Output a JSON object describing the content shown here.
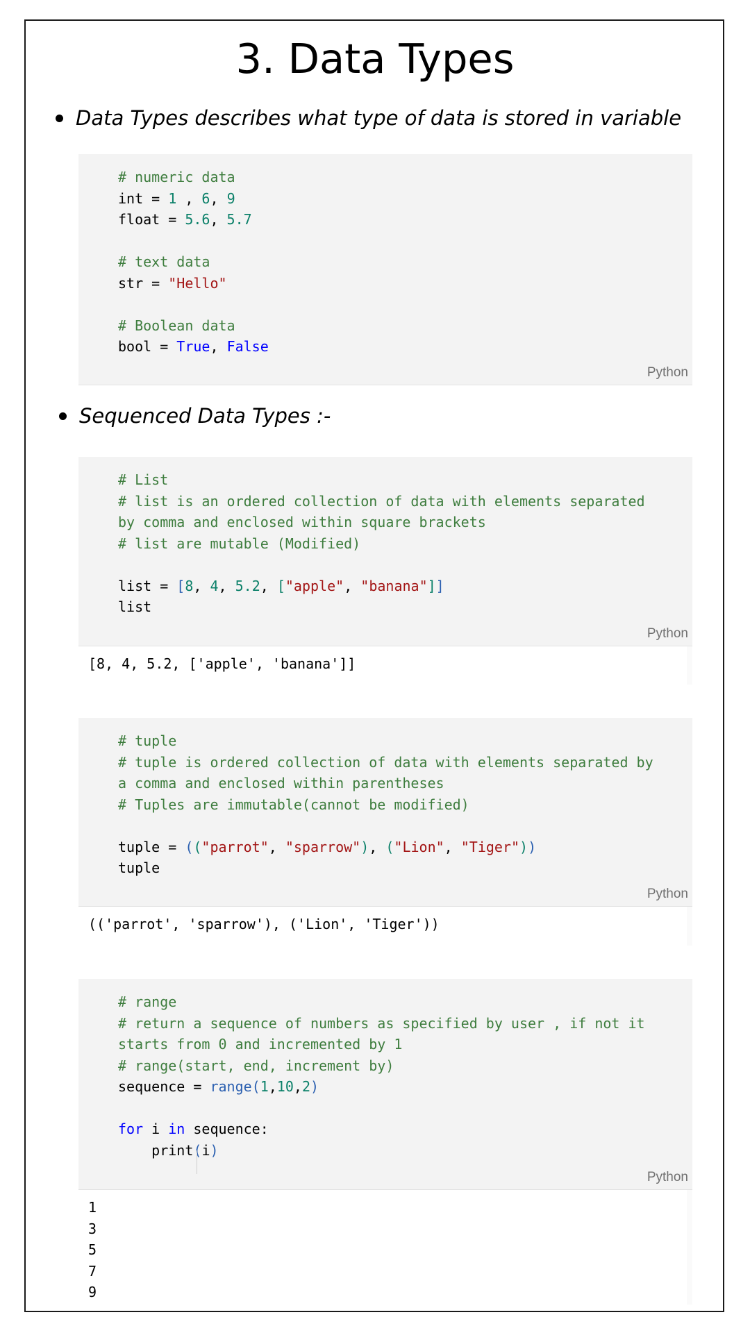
{
  "title": "3. Data Types",
  "bullet1": "Data Types describes what type of data is stored in variable",
  "bullet2": "Sequenced Data Types :-",
  "lang_label": "Python",
  "cell1": {
    "comment_numeric": "# numeric data",
    "int_line": [
      "int = ",
      "1",
      " , ",
      "6",
      ", ",
      "9"
    ],
    "float_line": [
      "float = ",
      "5.6",
      ", ",
      "5.7"
    ],
    "comment_text": "# text data",
    "str_line": [
      "str = ",
      "\"Hello\""
    ],
    "comment_bool": "# Boolean data",
    "bool_line": [
      "bool = ",
      "True",
      ", ",
      "False"
    ]
  },
  "cell2": {
    "c1": "# List",
    "c2": "# list is an ordered collection of data with elements separated",
    "c3": "by comma and enclosed within square brackets",
    "c4": "# list are mutable (Modified)",
    "code_a": "list = ",
    "code_b": "list",
    "output": "[8, 4, 5.2, ['apple', 'banana']]"
  },
  "cell3": {
    "c1": "# tuple",
    "c2": "# tuple is ordered collection of data with elements separated by",
    "c3": "a comma and enclosed within parentheses",
    "c4": "# Tuples are immutable(cannot be modified)",
    "code_a": "tuple = ",
    "code_b": "tuple",
    "output": "(('parrot', 'sparrow'), ('Lion', 'Tiger'))"
  },
  "cell4": {
    "c1": "# range",
    "c2": "# return a sequence of numbers as specified by user , if not it",
    "c3": "starts from 0 and incremented by 1",
    "c4": "# range(start, end, increment by)",
    "seq": "sequence = ",
    "for_kw": "for",
    "for_mid": " i ",
    "in_kw": "in",
    "for_end": " sequence:",
    "print": "print",
    "output": [
      "1",
      "3",
      "5",
      "7",
      "9"
    ]
  }
}
